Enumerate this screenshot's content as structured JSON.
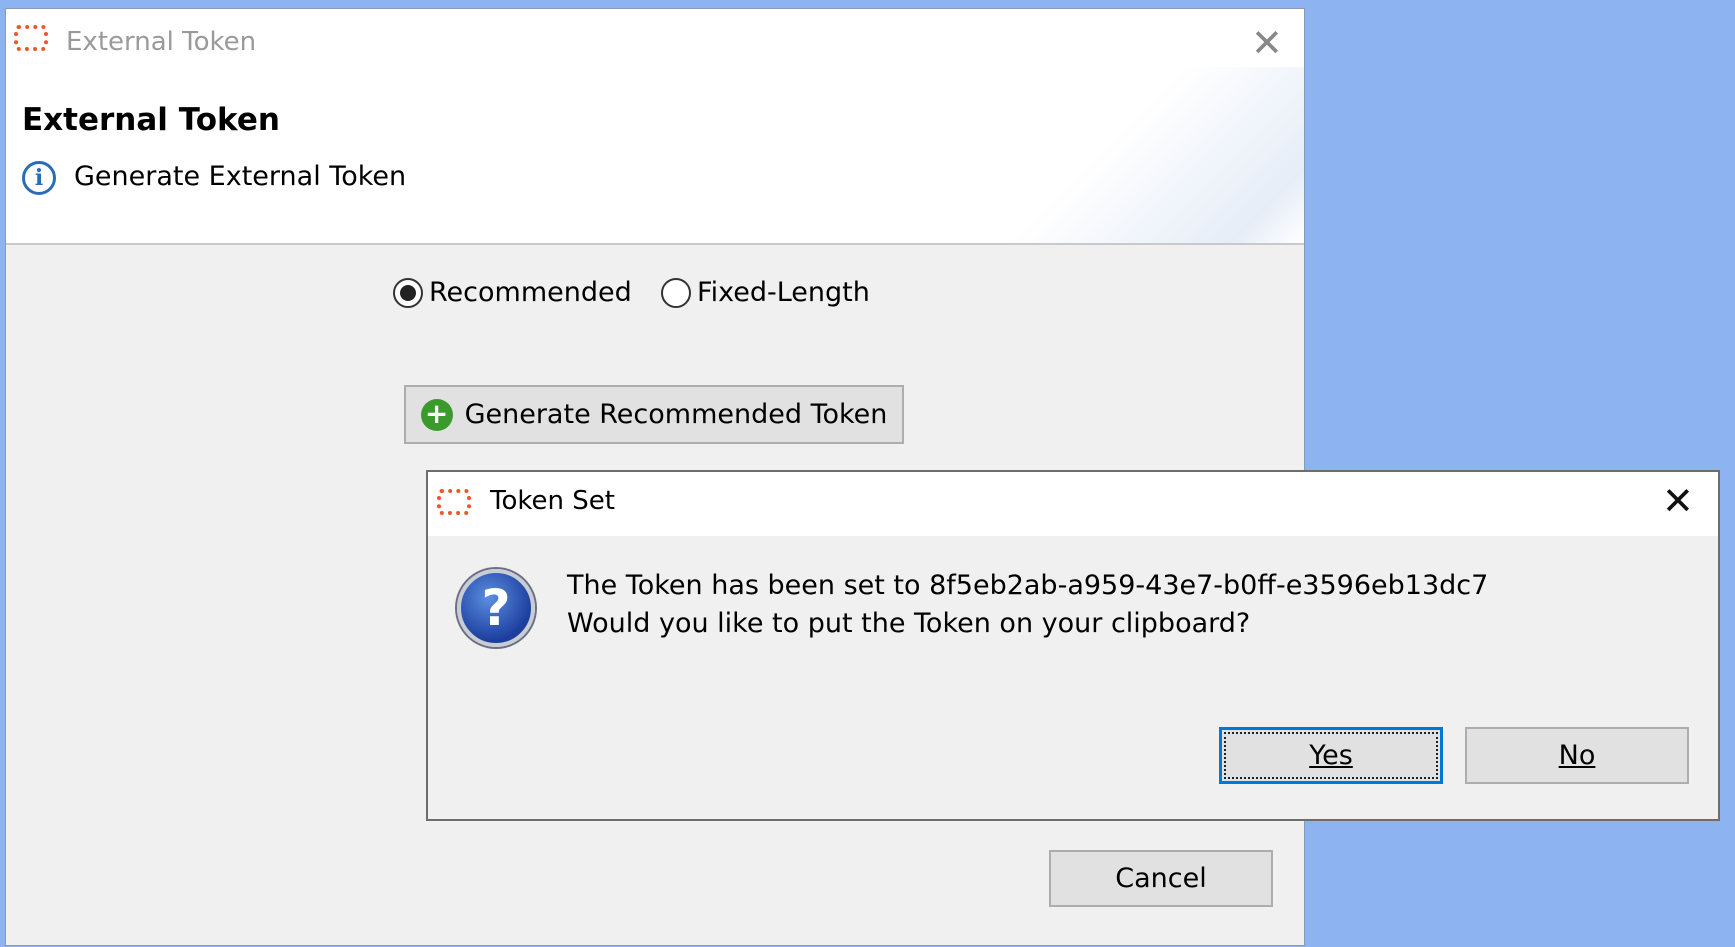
{
  "main_window": {
    "title": "External Token",
    "header_title": "External Token",
    "header_subtitle": "Generate External Token",
    "radio_options": [
      {
        "label": "Recommended",
        "selected": true
      },
      {
        "label": "Fixed-Length",
        "selected": false
      }
    ],
    "generate_button": "Generate Recommended Token",
    "cancel_button": "Cancel"
  },
  "dialog": {
    "title": "Token Set",
    "message_line1": "The Token has been set to 8f5eb2ab-a959-43e7-b0ff-e3596eb13dc7",
    "message_line2": "Would you like to put the Token on your clipboard?",
    "yes_button": "Yes",
    "no_button": "No"
  },
  "colors": {
    "desktop": "#8db4f0",
    "accent_icon": "#f0552a",
    "focus": "#0078d7"
  }
}
